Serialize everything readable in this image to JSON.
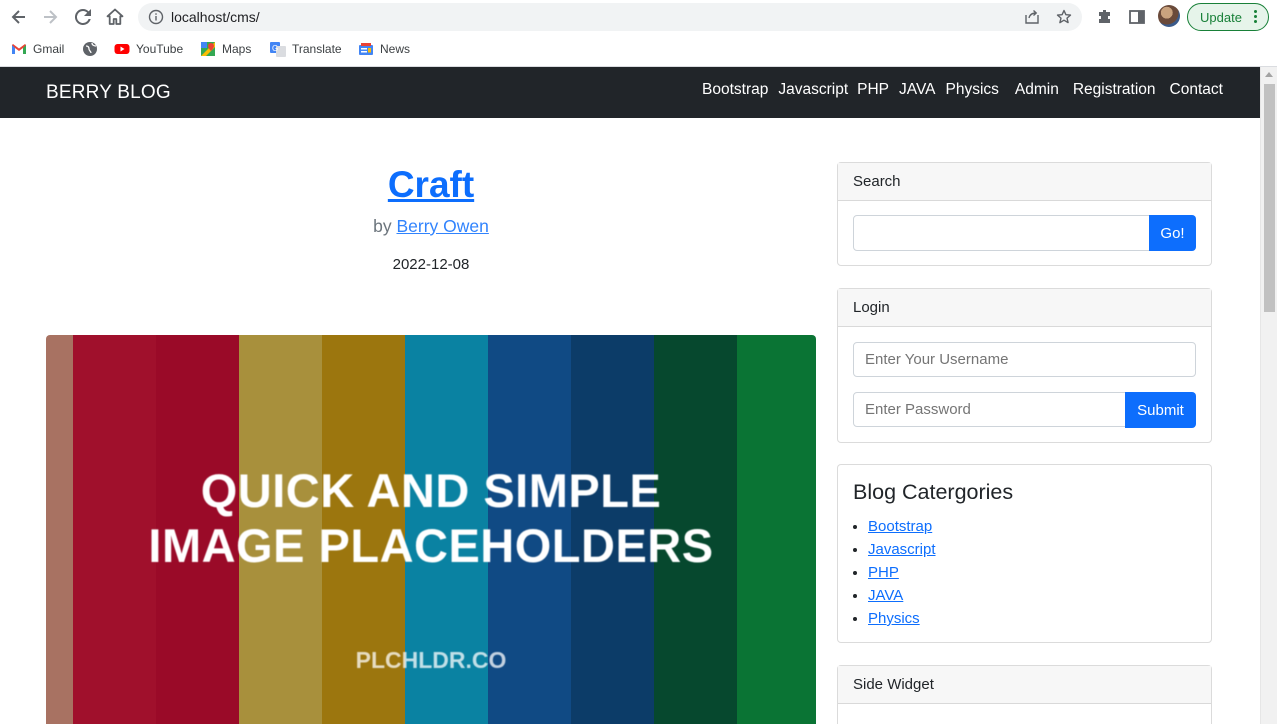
{
  "browser": {
    "url": "localhost/cms/",
    "update_label": "Update",
    "bookmarks": [
      {
        "label": "Gmail",
        "icon": "gmail-icon"
      },
      {
        "label": "",
        "icon": "globe-icon"
      },
      {
        "label": "YouTube",
        "icon": "youtube-icon"
      },
      {
        "label": "Maps",
        "icon": "maps-icon"
      },
      {
        "label": "Translate",
        "icon": "translate-icon"
      },
      {
        "label": "News",
        "icon": "news-icon"
      }
    ]
  },
  "navbar": {
    "brand": "BERRY BLOG",
    "links": [
      "Bootstrap",
      "Javascript",
      "PHP",
      "JAVA",
      "Physics",
      "Admin",
      "Registration",
      "Contact"
    ]
  },
  "post": {
    "title": "Craft",
    "by_prefix": "by ",
    "author": "Berry Owen",
    "date": "2022-12-08",
    "image": {
      "line1": "QUICK AND SIMPLE",
      "line2": "IMAGE PLACEHOLDERS",
      "sub": "PLCHLDR.CO",
      "stripe_colors": [
        "#a87262",
        "#a0102c",
        "#9a0a28",
        "#a8903c",
        "#9c760e",
        "#0a82a2",
        "#104a84",
        "#0c3c68",
        "#06482e",
        "#0a7434"
      ]
    }
  },
  "sidebar": {
    "search": {
      "header": "Search",
      "input_value": "",
      "button": "Go!"
    },
    "login": {
      "header": "Login",
      "username_placeholder": "Enter Your Username",
      "password_placeholder": "Enter Password",
      "button": "Submit"
    },
    "categories": {
      "title": "Blog Catergories",
      "items": [
        "Bootstrap",
        "Javascript",
        "PHP",
        "JAVA",
        "Physics"
      ]
    },
    "side_widget": {
      "header": "Side Widget"
    }
  },
  "colors": {
    "primary": "#0d6efd",
    "navbar": "#212529",
    "update_green": "#188038"
  }
}
